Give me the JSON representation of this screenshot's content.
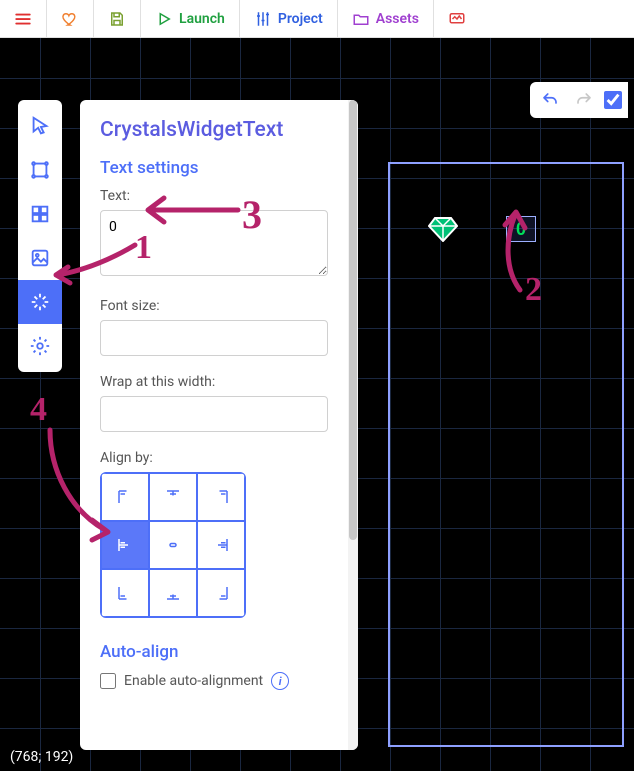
{
  "toolbar": {
    "launch": "Launch",
    "project": "Project",
    "assets": "Assets"
  },
  "inspector": {
    "title": "CrystalsWidgetText",
    "section_text_settings": "Text settings",
    "label_text": "Text:",
    "text_value": "0",
    "label_fontsize": "Font size:",
    "fontsize_value": "",
    "label_wrap": "Wrap at this width:",
    "wrap_value": "",
    "label_align": "Align by:",
    "section_autoalign": "Auto-align",
    "autoalign_checkbox": "Enable auto-alignment"
  },
  "canvas": {
    "text_widget_value": "0",
    "coords": "(768; 192)"
  },
  "annotations": {
    "n1": "1",
    "n2": "2",
    "n3": "3",
    "n4": "4"
  },
  "colors": {
    "accent": "#4d6ff8",
    "title": "#5b5ce0",
    "annotation": "#b5236a",
    "gem": "#00c176"
  }
}
